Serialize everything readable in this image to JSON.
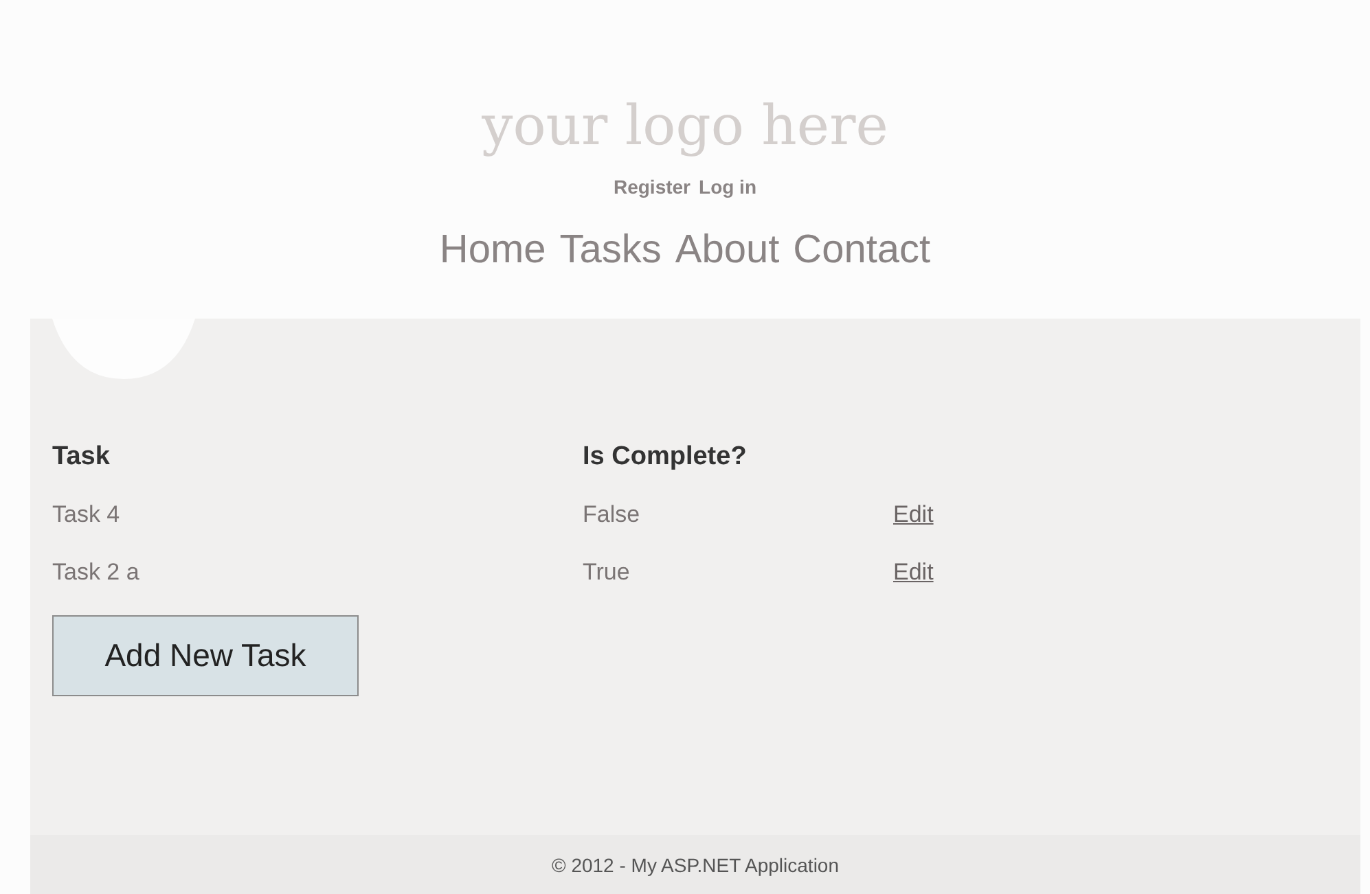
{
  "logo": "your logo here",
  "account_links": [
    "Register",
    "Log in"
  ],
  "nav": [
    "Home",
    "Tasks",
    "About",
    "Contact"
  ],
  "table": {
    "columns": [
      "Task",
      "Is Complete?"
    ],
    "rows": [
      {
        "task": "Task 4",
        "complete": "False",
        "action": "Edit"
      },
      {
        "task": "Task 2 a",
        "complete": "True",
        "action": "Edit"
      }
    ]
  },
  "add_button": "Add New Task",
  "footer": "© 2012 - My ASP.NET Application"
}
